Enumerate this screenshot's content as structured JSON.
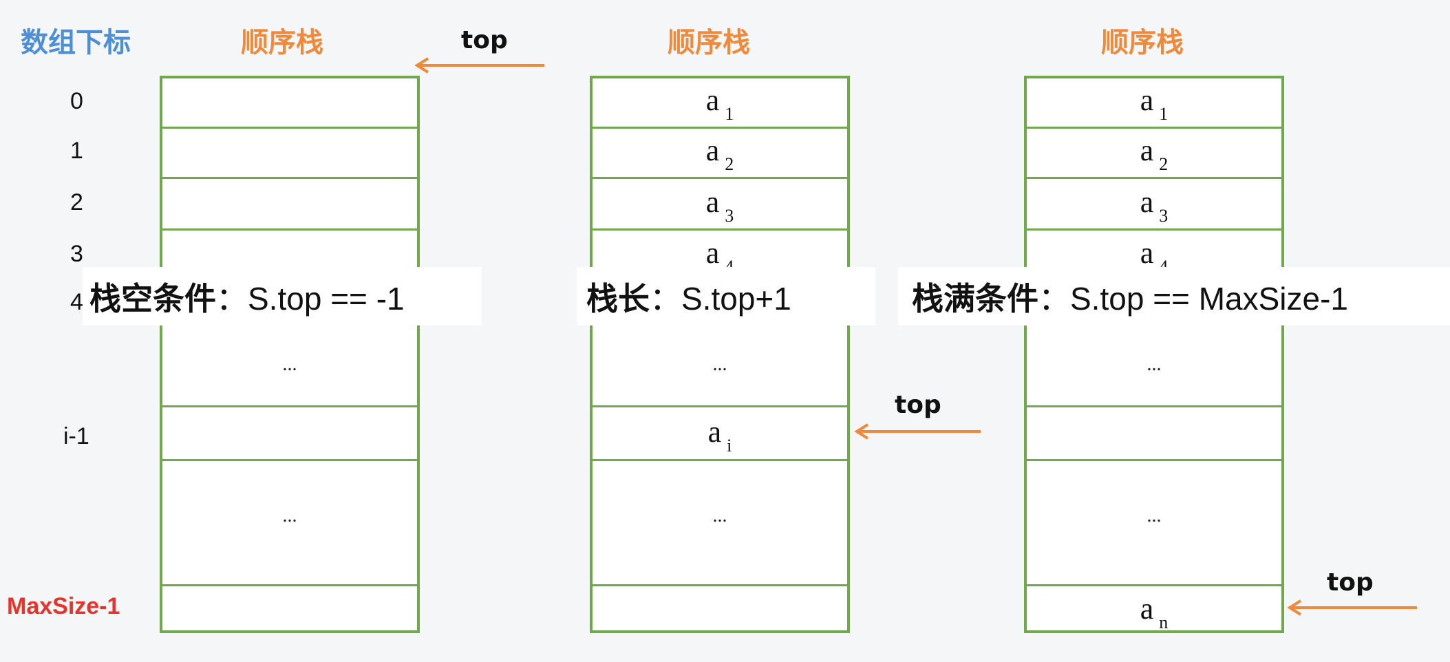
{
  "headers": {
    "index_title": "数组下标",
    "stack1_title": "顺序栈",
    "stack2_title": "顺序栈",
    "stack3_title": "顺序栈"
  },
  "indices": [
    "0",
    "1",
    "2",
    "3",
    "4",
    "i-1"
  ],
  "maxsize_label": "MaxSize-1",
  "top_label": "top",
  "stack2": {
    "cells": [
      {
        "base": "a",
        "sub": "1"
      },
      {
        "base": "a",
        "sub": "2"
      },
      {
        "base": "a",
        "sub": "3"
      },
      {
        "base": "a",
        "sub": "4"
      },
      {
        "base": "a",
        "sub": "i"
      }
    ]
  },
  "stack3": {
    "cells": [
      {
        "base": "a",
        "sub": "1"
      },
      {
        "base": "a",
        "sub": "2"
      },
      {
        "base": "a",
        "sub": "3"
      },
      {
        "base": "a",
        "sub": "4"
      },
      {
        "base": "a",
        "sub": "n"
      }
    ]
  },
  "ellipsis": "...",
  "banners": {
    "empty_bold": "栈空条件",
    "empty_rest": "：S.top == -1",
    "length_bold": "栈长",
    "length_rest": "：S.top+1",
    "full_bold": "栈满条件",
    "full_rest": "：S.top == MaxSize-1"
  },
  "colors": {
    "title_orange": "#f08a3a",
    "index_title_blue": "#4d8fd6",
    "maxsize_red": "#e8332a",
    "stack_border_green": "#6fa94c",
    "arrow_orange": "#f08a3a"
  }
}
